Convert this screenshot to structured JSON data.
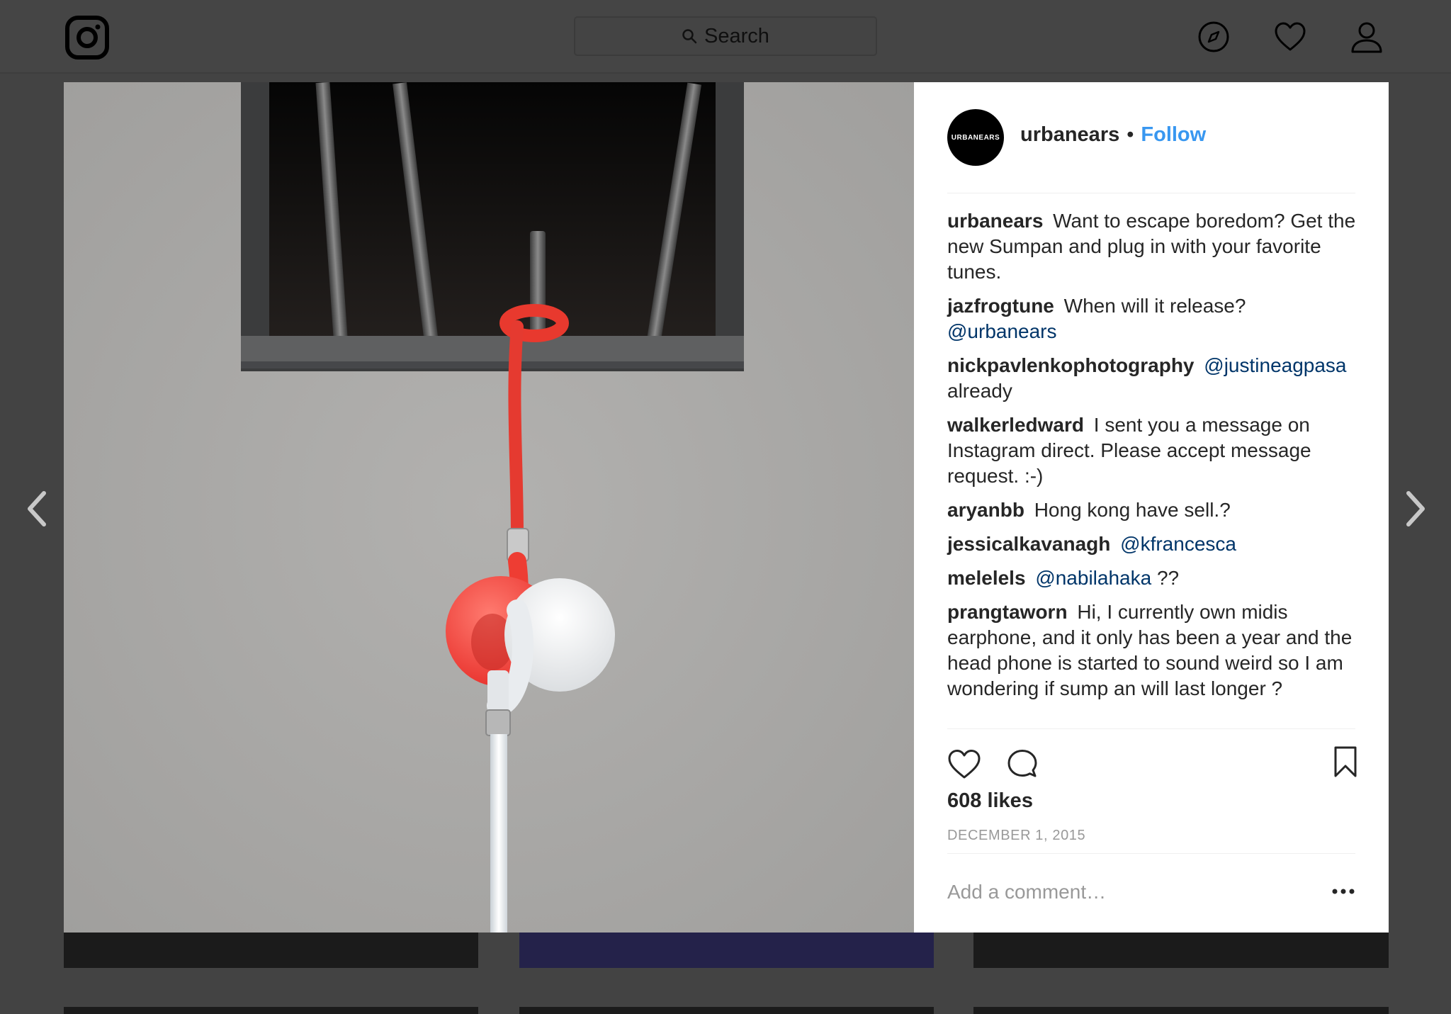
{
  "nav": {
    "search_placeholder": "Search",
    "icons": [
      "instagram-logo-icon",
      "explore-compass-icon",
      "activity-heart-icon",
      "profile-icon"
    ]
  },
  "post": {
    "account": {
      "username": "urbanears",
      "avatar_text": "URBANEARS",
      "follow_label": "Follow"
    },
    "caption": {
      "user": "urbanears",
      "text": "Want to escape boredom? Get the new Sumpan and plug in with your favorite tunes."
    },
    "comments": [
      {
        "user": "jazfrogtune",
        "text": "When will it release?",
        "mention": "@urbanears",
        "after": ""
      },
      {
        "user": "nickpavlenkophotography",
        "text": "",
        "mention": "@justineagpasa",
        "after": "already"
      },
      {
        "user": "walkerledward",
        "text": "I sent you a message on Instagram direct. Please accept message request. :-)",
        "mention": "",
        "after": ""
      },
      {
        "user": "aryanbb",
        "text": "Hong kong have sell.?",
        "mention": "",
        "after": ""
      },
      {
        "user": "jessicalkavanagh",
        "text": "",
        "mention": "@kfrancesca",
        "after": ""
      },
      {
        "user": "melelels",
        "text": "",
        "mention": "@nabilahaka",
        "after": "??"
      },
      {
        "user": "prangtaworn",
        "text": "Hi, I currently own midis earphone, and it only has been a year and the head phone is started to sound weird so I am wondering if sump an will last longer ?",
        "mention": "",
        "after": ""
      }
    ],
    "likes": "608 likes",
    "date": "DECEMBER 1, 2015",
    "add_comment_placeholder": "Add a comment…"
  },
  "colors": {
    "overlay": "#434343",
    "accent": "#3897f0",
    "mention": "#003569",
    "earbud_red": "#f04a4a"
  }
}
